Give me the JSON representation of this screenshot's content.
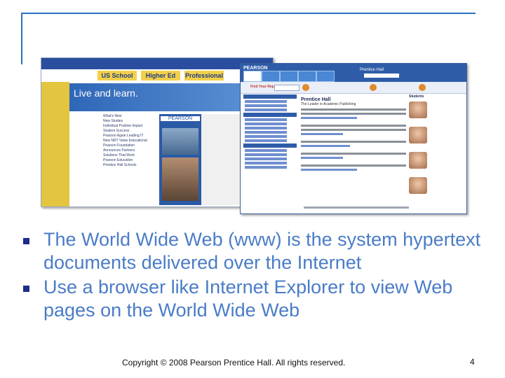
{
  "slide": {
    "bullets": [
      "The World Wide Web (www) is the system hypertext documents delivered over the Internet",
      "Use a browser like Internet Explorer to view Web pages on the World Wide Web"
    ],
    "copyright": "Copyright © 2008 Pearson Prentice Hall. All rights reserved.",
    "page_number": "4"
  },
  "screenshot_back": {
    "tabs": [
      "US School",
      "Higher Ed",
      "Professional"
    ],
    "banner_text": "Live and learn.",
    "logo": "PEARSON",
    "links": [
      "What's New",
      "New Studies",
      "Individual Positive Impact",
      "Student Success",
      "Pearson Again Leading IT",
      "New NRT Value Educational",
      "Pearson Foundation",
      "Announces Partners",
      "Solutions That Work",
      "Pearson Education",
      "Prentice Hall Schools"
    ]
  },
  "screenshot_front": {
    "brand": "PEARSON",
    "section_label": "Prentice Hall",
    "main_title": "Prentice Hall",
    "tagline": "The Leader in Academic Publishing",
    "search_label": "Find Your Rep",
    "right_heading": "Students"
  },
  "colors": {
    "accent": "#2a6fc0",
    "bullet_text": "#4a7cc7",
    "bullet_marker": "#1d2d8a",
    "pearson_blue": "#2f5ca8",
    "yellow": "#f2d04a"
  }
}
